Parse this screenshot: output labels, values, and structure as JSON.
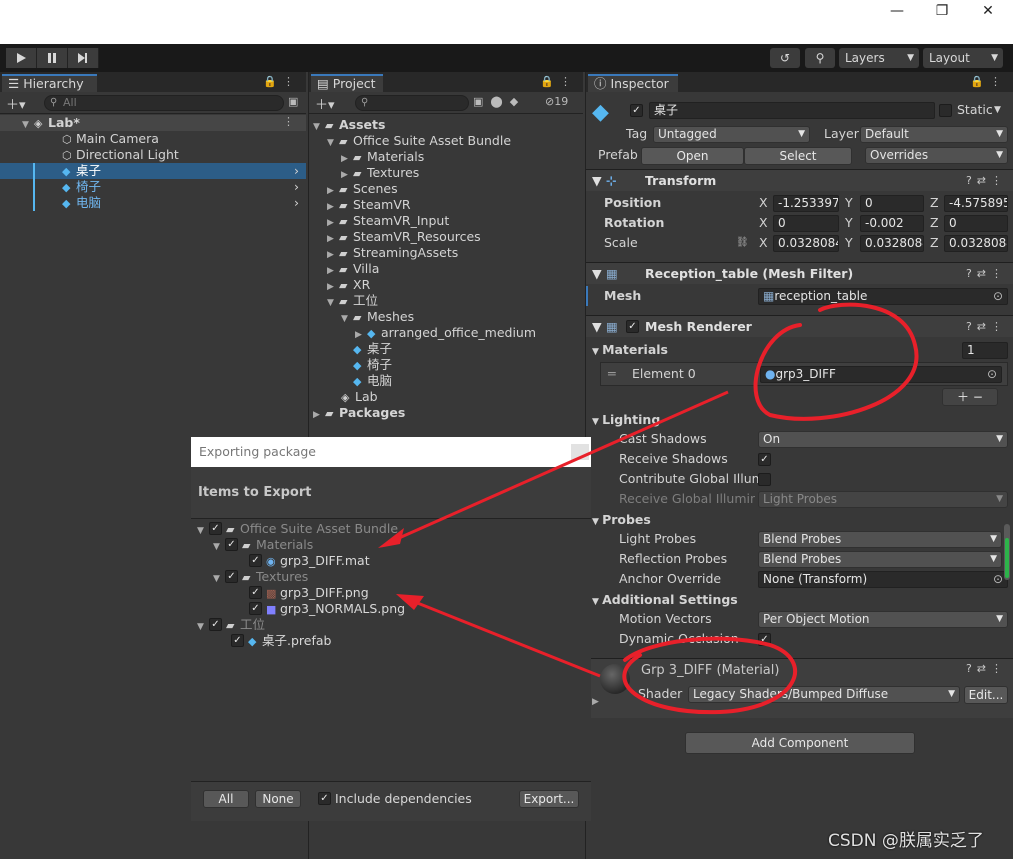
{
  "hierarchy": {
    "tab": "Hierarchy",
    "search_placeholder": "All",
    "scene": "Lab*",
    "items": [
      "Main Camera",
      "Directional Light",
      "桌子",
      "椅子",
      "电脑"
    ]
  },
  "project": {
    "tab": "Project",
    "hidden_count": "19",
    "tree": [
      {
        "label": "Assets"
      },
      {
        "label": "Office Suite Asset Bundle"
      },
      {
        "label": "Materials"
      },
      {
        "label": "Textures"
      },
      {
        "label": "Scenes"
      },
      {
        "label": "SteamVR"
      },
      {
        "label": "SteamVR_Input"
      },
      {
        "label": "SteamVR_Resources"
      },
      {
        "label": "StreamingAssets"
      },
      {
        "label": "Villa"
      },
      {
        "label": "XR"
      },
      {
        "label": "工位"
      },
      {
        "label": "Meshes"
      },
      {
        "label": "arranged_office_medium"
      },
      {
        "label": "桌子"
      },
      {
        "label": "椅子"
      },
      {
        "label": "电脑"
      },
      {
        "label": "Lab"
      },
      {
        "label": "Packages"
      }
    ]
  },
  "toolbar": {
    "layers": "Layers",
    "layout": "Layout"
  },
  "inspector": {
    "tab": "Inspector",
    "object_name": "桌子",
    "static_label": "Static",
    "tag_label": "Tag",
    "tag_value": "Untagged",
    "layer_label": "Layer",
    "layer_value": "Default",
    "prefab_label": "Prefab",
    "open": "Open",
    "select": "Select",
    "overrides": "Overrides",
    "transform": {
      "title": "Transform",
      "position_label": "Position",
      "position": [
        "-1.253397",
        "0",
        "-4.575895"
      ],
      "rotation_label": "Rotation",
      "rotation": [
        "0",
        "-0.002",
        "0"
      ],
      "scale_label": "Scale",
      "scale": [
        "0.0328084",
        "0.0328084",
        "0.0328084"
      ],
      "x": "X",
      "y": "Y",
      "z": "Z"
    },
    "mesh_filter": {
      "title": "Reception_table (Mesh Filter)",
      "mesh_label": "Mesh",
      "mesh_value": "reception_table"
    },
    "mesh_renderer": {
      "title": "Mesh Renderer",
      "materials_label": "Materials",
      "materials_count": "1",
      "element0_label": "Element 0",
      "element0_value": "grp3_DIFF",
      "lighting_label": "Lighting",
      "cast_shadows_label": "Cast Shadows",
      "cast_shadows_value": "On",
      "receive_shadows_label": "Receive Shadows",
      "contribute_gi_label": "Contribute Global Illumi",
      "receive_gi_label": "Receive Global Illuminat",
      "receive_gi_value": "Light Probes",
      "probes_label": "Probes",
      "light_probes_label": "Light Probes",
      "light_probes_value": "Blend Probes",
      "reflection_probes_label": "Reflection Probes",
      "reflection_probes_value": "Blend Probes",
      "anchor_override_label": "Anchor Override",
      "anchor_override_value": "None (Transform)",
      "additional_label": "Additional Settings",
      "motion_vectors_label": "Motion Vectors",
      "motion_vectors_value": "Per Object Motion",
      "dynamic_occlusion_label": "Dynamic Occlusion"
    },
    "material": {
      "title": "Grp 3_DIFF (Material)",
      "shader_label": "Shader",
      "shader_value": "Legacy Shaders/Bumped Diffuse",
      "edit": "Edit..."
    },
    "add_component": "Add Component"
  },
  "export_dialog": {
    "title": "Exporting package",
    "heading": "Items to Export",
    "items": [
      "Office Suite Asset Bundle",
      "Materials",
      "grp3_DIFF.mat",
      "Textures",
      "grp3_DIFF.png",
      "grp3_NORMALS.png",
      "工位",
      "桌子.prefab"
    ],
    "all_btn": "All",
    "none_btn": "None",
    "include_deps": "Include dependencies",
    "export_btn": "Export..."
  },
  "watermark": "CSDN @朕属实乏了",
  "colors": {
    "accent": "#3a79bb",
    "selection": "#2c5d87",
    "annotation": "#e8202a",
    "prefab_blue": "#56b7f0"
  }
}
